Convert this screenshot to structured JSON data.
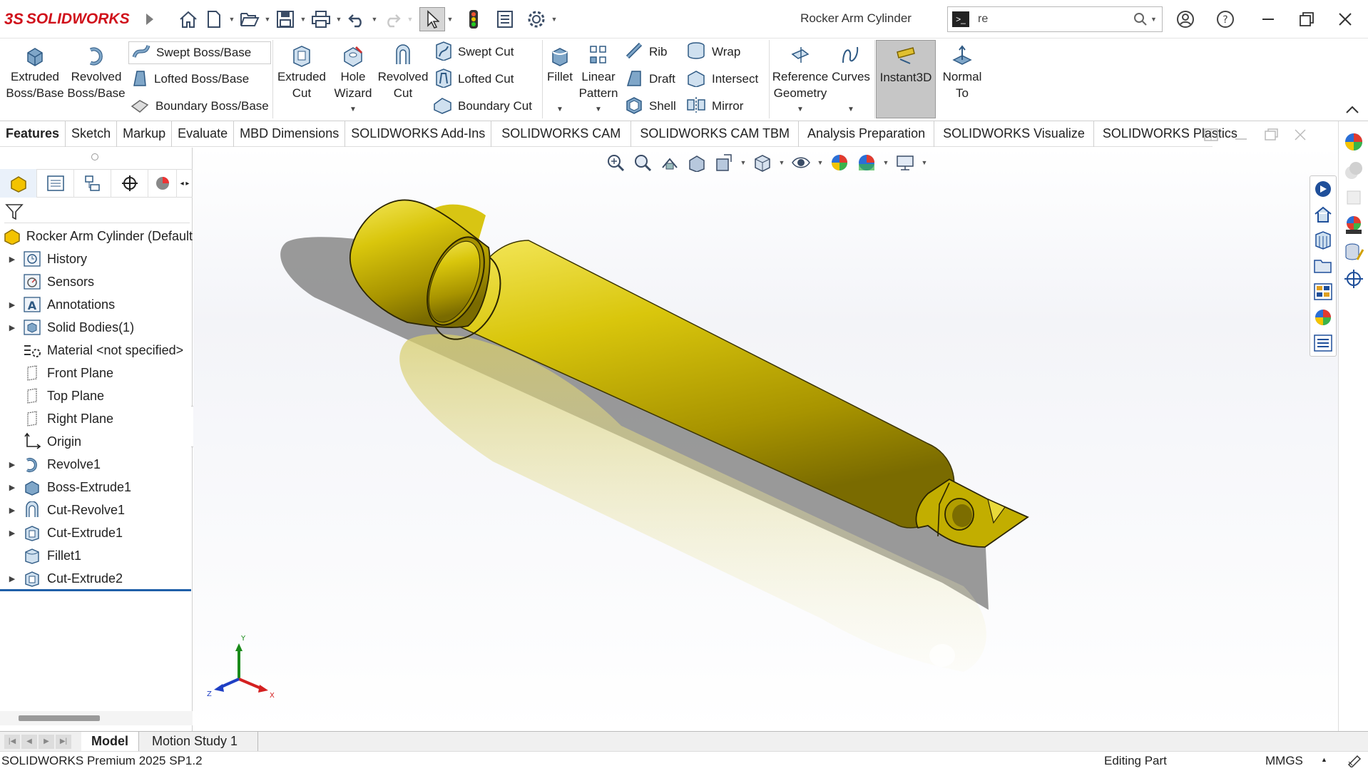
{
  "app": {
    "logo_ds": "3S",
    "logo_name": "SOLIDWORKS",
    "doc_title": "Rocker Arm Cylinder"
  },
  "search": {
    "value": "re",
    "prompt_icon": "terminal-icon"
  },
  "ribbon": {
    "extruded_boss": [
      "Extruded",
      "Boss/Base"
    ],
    "revolved_boss": [
      "Revolved",
      "Boss/Base"
    ],
    "swept_boss": "Swept Boss/Base",
    "lofted_boss": "Lofted Boss/Base",
    "boundary_boss": "Boundary Boss/Base",
    "extruded_cut": [
      "Extruded",
      "Cut"
    ],
    "hole_wizard": [
      "Hole",
      "Wizard"
    ],
    "revolved_cut": [
      "Revolved",
      "Cut"
    ],
    "swept_cut": "Swept Cut",
    "lofted_cut": "Lofted Cut",
    "boundary_cut": "Boundary Cut",
    "fillet": "Fillet",
    "linear_pattern": [
      "Linear",
      "Pattern"
    ],
    "rib": "Rib",
    "draft": "Draft",
    "shell": "Shell",
    "wrap": "Wrap",
    "intersect": "Intersect",
    "mirror": "Mirror",
    "reference_geometry": [
      "Reference",
      "Geometry"
    ],
    "curves": "Curves",
    "instant3d": "Instant3D",
    "normal_to": [
      "Normal",
      "To"
    ]
  },
  "tabs": [
    "Features",
    "Sketch",
    "Markup",
    "Evaluate",
    "MBD Dimensions",
    "SOLIDWORKS Add-Ins",
    "SOLIDWORKS CAM",
    "SOLIDWORKS CAM TBM",
    "Analysis Preparation",
    "SOLIDWORKS Visualize",
    "SOLIDWORKS Plastics"
  ],
  "tree": {
    "root": "Rocker Arm Cylinder  (Default",
    "items": [
      "History",
      "Sensors",
      "Annotations",
      "Solid Bodies(1)",
      "Material <not specified>",
      "Front Plane",
      "Top Plane",
      "Right Plane",
      "Origin",
      "Revolve1",
      "Boss-Extrude1",
      "Cut-Revolve1",
      "Cut-Extrude1",
      "Fillet1",
      "Cut-Extrude2"
    ]
  },
  "triad": {
    "x": "X",
    "y": "Y",
    "z": "Z"
  },
  "bottom_tabs": [
    "Model",
    "Motion Study 1"
  ],
  "status": {
    "product": "SOLIDWORKS Premium 2025 SP1.2",
    "mode": "Editing Part",
    "units": "MMGS"
  },
  "colors": {
    "part": "#c8b400",
    "brand_red": "#d0111b",
    "selection_blue": "#1f5fa8"
  }
}
